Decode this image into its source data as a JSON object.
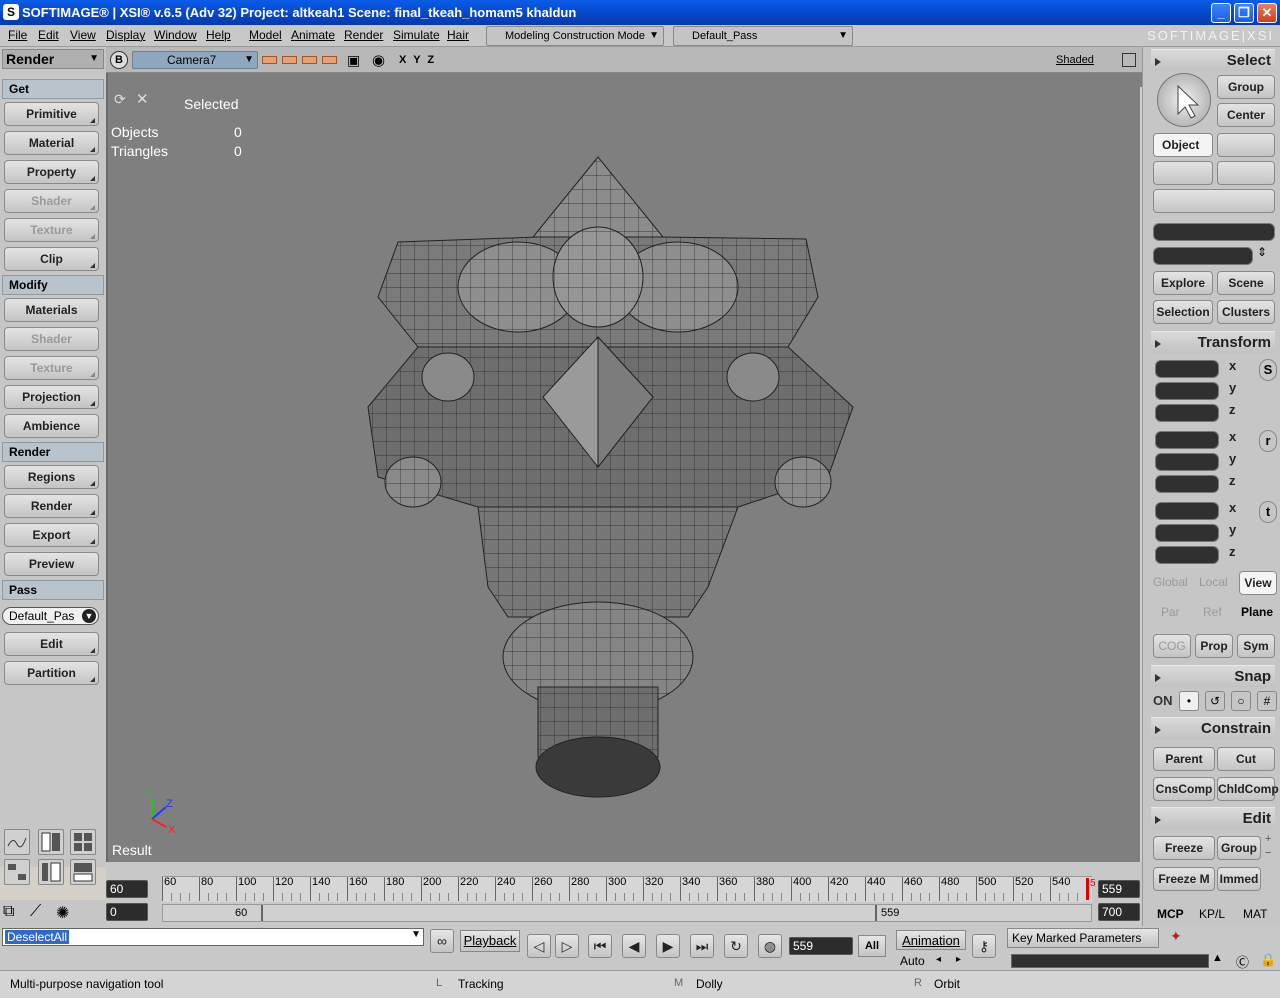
{
  "window": {
    "title": "SOFTIMAGE® | XSI® v.6.5 (Adv 32) Project: altkeah1     Scene: final_tkeah_homam5 khaldun",
    "app_icon": "xsi-icon"
  },
  "menu": {
    "items": [
      "File",
      "Edit",
      "View",
      "Display",
      "Window",
      "Help",
      "Model",
      "Animate",
      "Render",
      "Simulate",
      "Hair"
    ],
    "mode": "Modeling Construction Mode",
    "pass": "Default_Pass",
    "brand": "SOFTIMAGE|XSI"
  },
  "left_panel": {
    "toolbar_title": "Render",
    "sections": [
      {
        "title": "Get",
        "buttons": [
          {
            "label": "Primitive",
            "enabled": true
          },
          {
            "label": "Material",
            "enabled": true
          },
          {
            "label": "Property",
            "enabled": true
          },
          {
            "label": "Shader",
            "enabled": false
          },
          {
            "label": "Texture",
            "enabled": false
          },
          {
            "label": "Clip",
            "enabled": true
          }
        ]
      },
      {
        "title": "Modify",
        "buttons": [
          {
            "label": "Materials",
            "enabled": true
          },
          {
            "label": "Shader",
            "enabled": false
          },
          {
            "label": "Texture",
            "enabled": false
          },
          {
            "label": "Projection",
            "enabled": true
          },
          {
            "label": "Ambience",
            "enabled": true
          }
        ]
      },
      {
        "title": "Render",
        "buttons": [
          {
            "label": "Regions",
            "enabled": true
          },
          {
            "label": "Render",
            "enabled": true
          },
          {
            "label": "Export",
            "enabled": true
          },
          {
            "label": "Preview",
            "enabled": true
          }
        ]
      },
      {
        "title": "Pass",
        "buttons": []
      }
    ],
    "pass_select": "Default_Pas",
    "pass_buttons": [
      "Edit",
      "Partition"
    ]
  },
  "viewport": {
    "camera": "Camera7",
    "axes": "X Y Z",
    "shading": "Shaded",
    "badge": "B",
    "selected_label": "Selected",
    "stats": [
      {
        "label": "Objects",
        "value": "0"
      },
      {
        "label": "Triangles",
        "value": "0"
      }
    ],
    "result_label": "Result",
    "axis_labels": {
      "x": "X",
      "y": "Y",
      "z": "Z"
    }
  },
  "timeline": {
    "start": "60",
    "end": "559",
    "current": "559",
    "total": "700",
    "range_start": "0",
    "range_low": "60",
    "range_high": "559",
    "ticks": [
      "60",
      "80",
      "100",
      "120",
      "140",
      "160",
      "180",
      "200",
      "220",
      "240",
      "260",
      "280",
      "300",
      "320",
      "340",
      "360",
      "380",
      "400",
      "420",
      "440",
      "460",
      "480",
      "500",
      "520",
      "540"
    ],
    "marker": "5"
  },
  "command": {
    "value": "DeselectAll",
    "playback_label": "Playback",
    "frame": "559",
    "all_label": "All",
    "animation_label": "Animation",
    "auto_label": "Auto",
    "key_marked": "Key Marked Parameters"
  },
  "status": {
    "hint": "Multi-purpose navigation tool",
    "left_key": "L",
    "left_action": "Tracking",
    "mid_key": "M",
    "mid_action": "Dolly",
    "right_key": "R",
    "right_action": "Orbit"
  },
  "right_panel": {
    "select_title": "Select",
    "select_buttons": [
      "Group",
      "Center",
      "Object"
    ],
    "explore_buttons": [
      "Explore",
      "Scene",
      "Selection",
      "Clusters"
    ],
    "transform_title": "Transform",
    "axes": [
      "x",
      "y",
      "z"
    ],
    "transform_icons": [
      "S",
      "r",
      "t"
    ],
    "ref_buttons": [
      "Global",
      "Local",
      "View",
      "Par",
      "Ref",
      "Plane",
      "COG",
      "Prop",
      "Sym"
    ],
    "snap_title": "Snap",
    "snap_on": "ON",
    "constrain_title": "Constrain",
    "constrain_buttons": [
      "Parent",
      "Cut",
      "CnsComp",
      "ChldComp"
    ],
    "edit_title": "Edit",
    "edit_buttons": [
      "Freeze",
      "Group",
      "Freeze M",
      "Immed"
    ],
    "tabs": [
      "MCP",
      "KP/L",
      "MAT"
    ]
  }
}
